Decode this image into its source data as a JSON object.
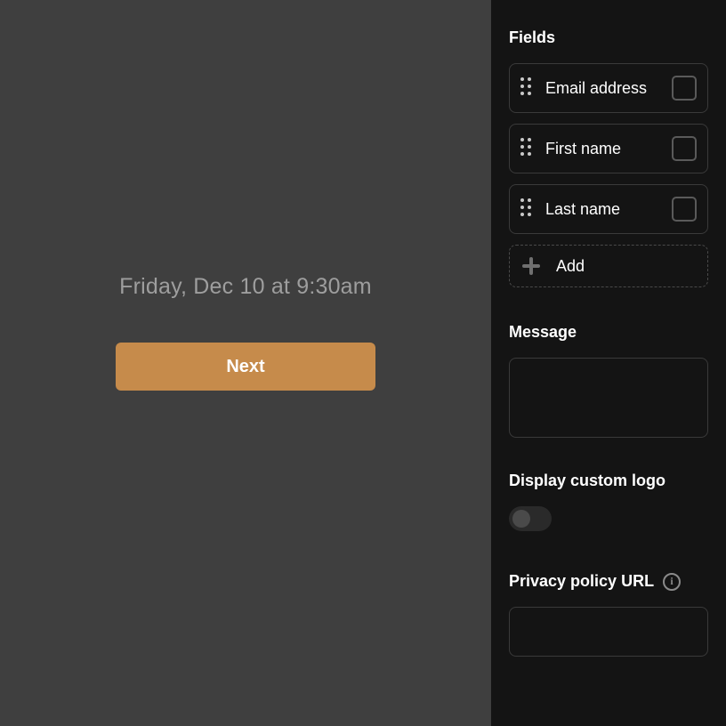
{
  "preview": {
    "datetime_text": "Friday, Dec 10 at 9:30am",
    "next_label": "Next"
  },
  "sidebar": {
    "fields_heading": "Fields",
    "fields": [
      {
        "label": "Email address"
      },
      {
        "label": "First name"
      },
      {
        "label": "Last name"
      }
    ],
    "add_label": "Add",
    "message_heading": "Message",
    "message_value": "",
    "logo_heading": "Display custom logo",
    "logo_toggle_on": false,
    "privacy_heading": "Privacy policy URL",
    "privacy_url_value": ""
  }
}
